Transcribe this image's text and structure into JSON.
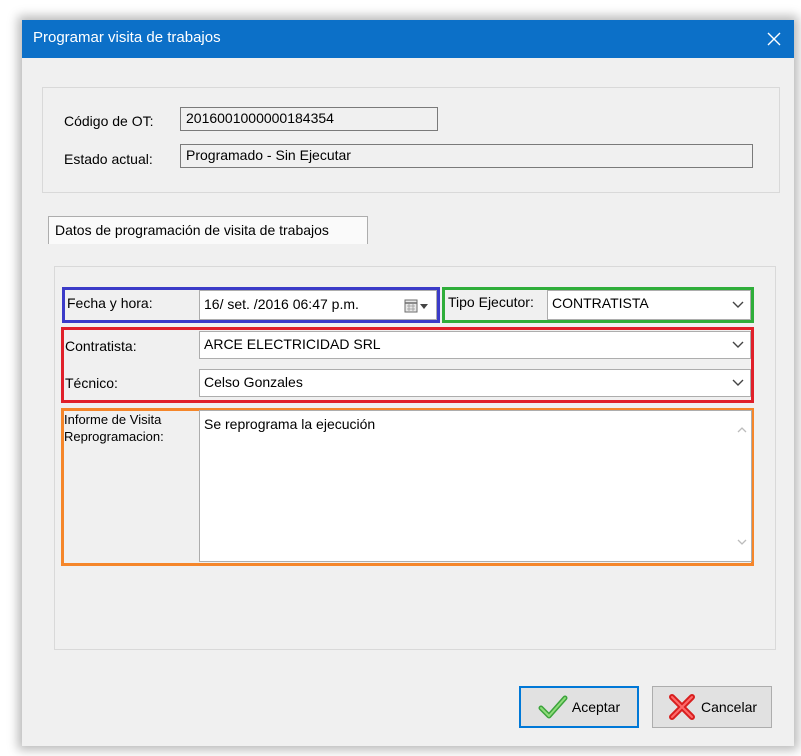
{
  "window": {
    "title": "Programar visita de trabajos"
  },
  "header": {
    "codigo_label": "Código de OT:",
    "codigo_value": "2016001000000184354",
    "estado_label": "Estado actual:",
    "estado_value": "Programado - Sin Ejecutar"
  },
  "tab": {
    "label": "Datos de programación de visita de trabajos"
  },
  "form": {
    "fecha_label": "Fecha y hora:",
    "fecha_value": "16/ set. /2016 06:47 p.m.",
    "tipo_label": "Tipo Ejecutor:",
    "tipo_value": "CONTRATISTA",
    "contratista_label": "Contratista:",
    "contratista_value": "ARCE ELECTRICIDAD SRL",
    "tecnico_label": "Técnico:",
    "tecnico_value": "Celso Gonzales",
    "informe_label_1": "Informe de Visita",
    "informe_label_2": "Reprogramacion:",
    "informe_value": "Se reprograma la ejecución"
  },
  "buttons": {
    "accept_label": "Aceptar",
    "cancel_label": "Cancelar"
  },
  "icons": {
    "close": "close-icon",
    "calendar": "calendar-icon",
    "dropdown": "chevron-down-icon",
    "accept": "checkmark-icon",
    "cancel": "red-x-icon"
  },
  "colors": {
    "titlebar": "#0c70c8",
    "highlight_fecha": "#3b3bc8",
    "highlight_tipo": "#2fae3a",
    "highlight_contratista": "#e0202a",
    "highlight_informe": "#f5862a",
    "accept_focus": "#0078d7"
  }
}
